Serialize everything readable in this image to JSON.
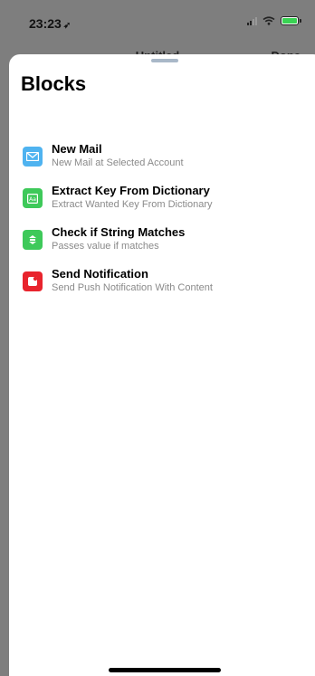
{
  "status_bar": {
    "time": "23:23",
    "location_icon": "location-arrow-icon",
    "battery_color": "#39d353"
  },
  "behind": {
    "title": "Untitled",
    "done_label": "Done"
  },
  "sheet": {
    "title": "Blocks",
    "items": [
      {
        "title": "New Mail",
        "subtitle": "New Mail at Selected Account",
        "icon": "mail-icon",
        "color": "#4fb3f0"
      },
      {
        "title": "Extract Key From Dictionary",
        "subtitle": "Extract Wanted Key From Dictionary",
        "icon": "dictionary-icon",
        "color": "#3ec95a"
      },
      {
        "title": "Check if String Matches",
        "subtitle": "Passes value if matches",
        "icon": "filter-icon",
        "color": "#3ec95a"
      },
      {
        "title": "Send Notification",
        "subtitle": "Send Push Notification With Content",
        "icon": "notification-icon",
        "color": "#e8242d"
      }
    ]
  }
}
